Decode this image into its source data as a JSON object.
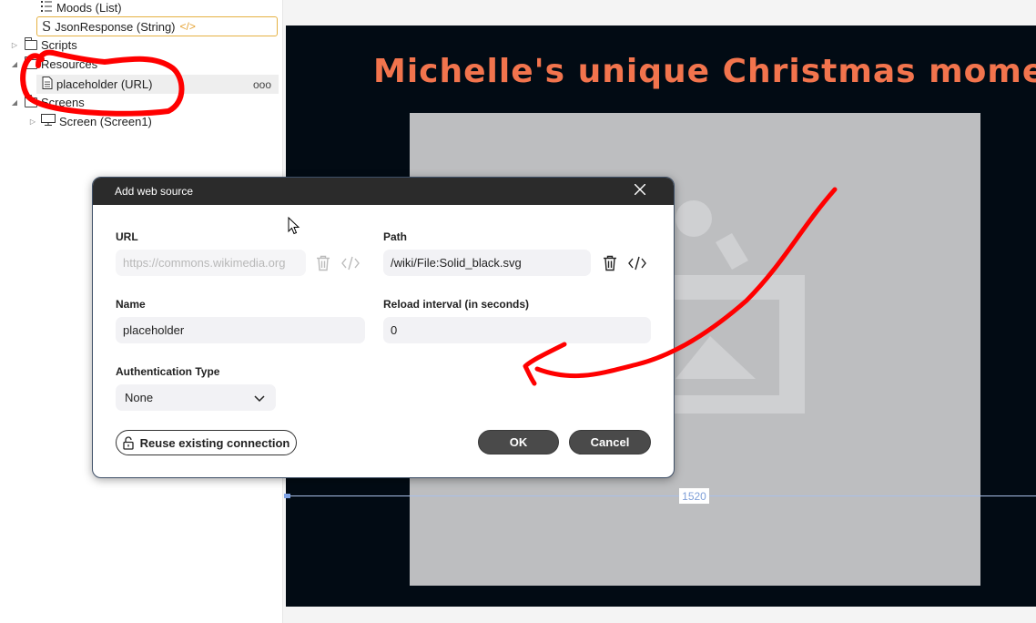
{
  "tree": {
    "items": [
      {
        "label": "Moods (List)"
      },
      {
        "label": "JsonResponse (String)"
      },
      {
        "label": "Scripts"
      },
      {
        "label": "Resources"
      },
      {
        "label": "placeholder (URL)"
      },
      {
        "label": "Screens"
      },
      {
        "label": "Screen (Screen1)"
      }
    ],
    "more_label": "ooo",
    "code_glyph": "</>"
  },
  "canvas": {
    "title": "Michelle's unique Christmas moment",
    "guide_value": "1520",
    "colors": {
      "stage": "#020b14",
      "title": "#f2744d",
      "image": "#bdbec0"
    }
  },
  "dialog": {
    "title": "Add web source",
    "url_label": "URL",
    "url_placeholder": "https://commons.wikimedia.org",
    "path_label": "Path",
    "path_value": "/wiki/File:Solid_black.svg",
    "name_label": "Name",
    "name_value": "placeholder",
    "reload_label": "Reload interval (in seconds)",
    "reload_value": "0",
    "auth_label": "Authentication Type",
    "auth_value": "None",
    "reuse_label": "Reuse existing connection",
    "ok_label": "OK",
    "cancel_label": "Cancel"
  },
  "annotations": {
    "color": "#ff0000"
  }
}
